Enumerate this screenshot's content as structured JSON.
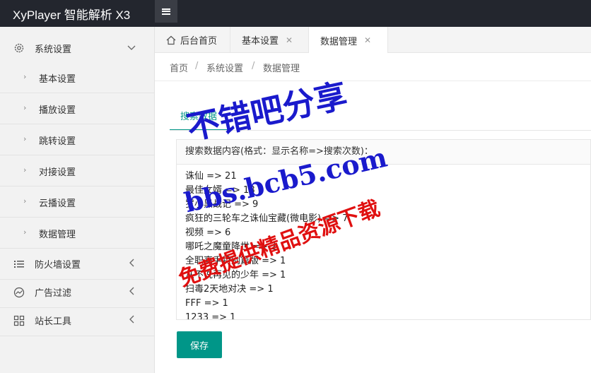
{
  "header": {
    "title": "XyPlayer 智能解析 X3"
  },
  "sidebar": {
    "system": {
      "label": "系统设置",
      "icon": "gear-icon"
    },
    "sub": [
      {
        "label": "基本设置"
      },
      {
        "label": "播放设置"
      },
      {
        "label": "跳转设置"
      },
      {
        "label": "对接设置"
      },
      {
        "label": "云播设置"
      },
      {
        "label": "数据管理"
      }
    ],
    "firewall": {
      "label": "防火墙设置",
      "icon": "list-icon"
    },
    "ads": {
      "label": "广告过滤",
      "icon": "chart-icon"
    },
    "tools": {
      "label": "站长工具",
      "icon": "grid-icon"
    }
  },
  "tabs": [
    {
      "label": "后台首页"
    },
    {
      "label": "基本设置"
    },
    {
      "label": "数据管理"
    }
  ],
  "breadcrumb": {
    "home": "首页",
    "level1": "系统设置",
    "level2": "数据管理",
    "sep": "/"
  },
  "content": {
    "subtab": "搜索数据",
    "field_label": "搜索数据内容(格式：显示名称=>搜索次数)：",
    "lines": [
      "诛仙 => 21",
      "最佳女婿 => 18",
      "罗小黑战记 => 9",
      "疯狂的三轮车之诛仙宝藏(微电影) => 7",
      "视频 => 6",
      "哪吒之魔童降世 => 2",
      "全职高手特别篇版 => 1",
      "从不说再见的少年 => 1",
      "扫毒2天地对决 => 1",
      "FFF => 1",
      "1233 => 1"
    ],
    "save": "保存"
  },
  "watermark": {
    "line1": "不错吧分享",
    "line2": "bbs.bcb5.com",
    "line3": "免费提供精品资源下载"
  }
}
